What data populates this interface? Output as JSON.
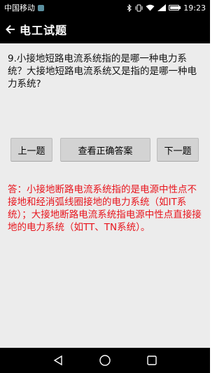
{
  "status_bar": {
    "carrier": "中国移动",
    "time": "19:23",
    "battery_level": 0.9
  },
  "app_bar": {
    "title": "电工试题"
  },
  "question": {
    "text": "9.小接地短路电流系统指的是哪一种电力系统？大接地短路电流系统又是指的是哪一种电力系统?"
  },
  "buttons": {
    "prev": "上一题",
    "answer": "查看正确答案",
    "next": "下一题"
  },
  "answer": {
    "text": "答：小接地断路电流系统指的是电源中性点不接地和经消弧线圈接地的电力系统（如IT系统）；大接地断路电流系统指电源中性点直接接地的电力系统（如TT、TN系统）。"
  },
  "colors": {
    "answer_text": "#e8141c",
    "content_bg": "#ececec",
    "bar_bg": "#000000"
  },
  "icons": {
    "back": "arrow-left-icon",
    "nav_back": "triangle-back-icon",
    "nav_home": "circle-home-icon",
    "nav_recent": "square-recent-icon"
  }
}
